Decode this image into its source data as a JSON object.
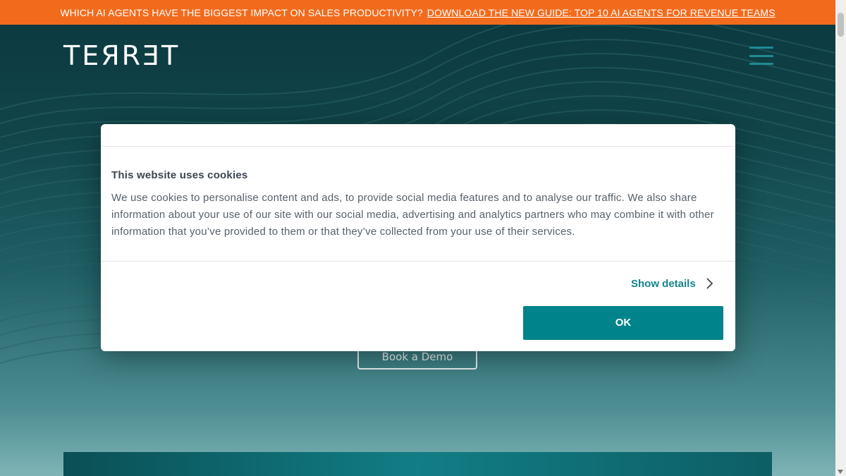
{
  "announcement": {
    "text": "WHICH AI AGENTS HAVE THE BIGGEST IMPACT ON SALES PRODUCTIVITY?",
    "link_text": "DOWNLOAD THE NEW GUIDE: TOP 10 AI AGENTS FOR REVENUE TEAMS"
  },
  "header": {
    "logo_text": "TEЯRƎT",
    "menu_icon": "hamburger-menu-icon"
  },
  "hero": {
    "cta_label": "Book a Demo"
  },
  "cookie_dialog": {
    "title": "This website uses cookies",
    "body": "We use cookies to personalise content and ads, to provide social media features and to analyse our traffic. We also share information about your use of our site with our social media, advertising and analytics partners who may combine it with other information that you’ve provided to them or that they’ve collected from your use of their services.",
    "show_details_label": "Show details",
    "ok_label": "OK"
  },
  "colors": {
    "announcement_bg": "#f26b1d",
    "accent": "#00838a",
    "hero_dark": "#0c3a40"
  }
}
